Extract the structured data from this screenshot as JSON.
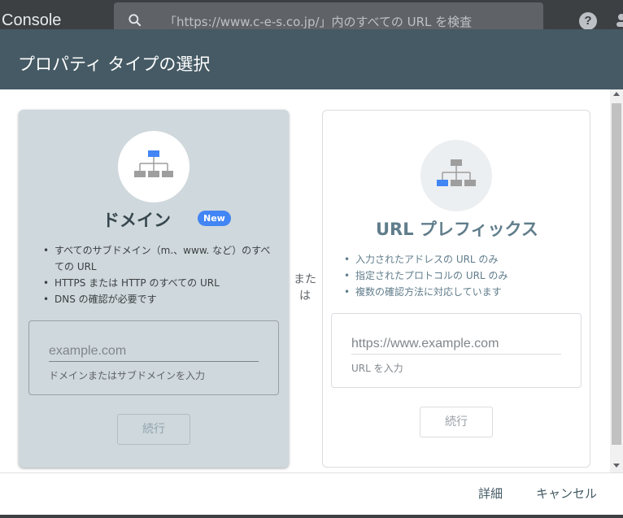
{
  "app": {
    "title": "Console",
    "search_text": "「https://www.c-e-s.co.jp/」内のすべての URL を検査",
    "help_label": "?"
  },
  "dialog": {
    "title": "プロパティ タイプの選択",
    "or_text": "または",
    "domain": {
      "title": "ドメイン",
      "badge": "New",
      "bullets": [
        "すべてのサブドメイン（m.、www. など）のすべての URL",
        "HTTPS または HTTP のすべての URL",
        "DNS の確認が必要です"
      ],
      "input_placeholder": "example.com",
      "helper": "ドメインまたはサブドメインを入力",
      "continue_label": "続行",
      "icon": "sitemap-icon"
    },
    "url": {
      "title": "URL プレフィックス",
      "bullets": [
        "入力されたアドレスの URL のみ",
        "指定されたプロトコルの URL のみ",
        "複数の確認方法に対応しています"
      ],
      "input_placeholder": "https://www.example.com",
      "helper": "URL を入力",
      "continue_label": "続行",
      "icon": "sitemap-icon"
    },
    "footer": {
      "details_label": "詳細",
      "cancel_label": "キャンセル"
    }
  },
  "colors": {
    "header": "#455a64",
    "accent": "#4285f4",
    "domain_card": "#cfd8dc"
  }
}
